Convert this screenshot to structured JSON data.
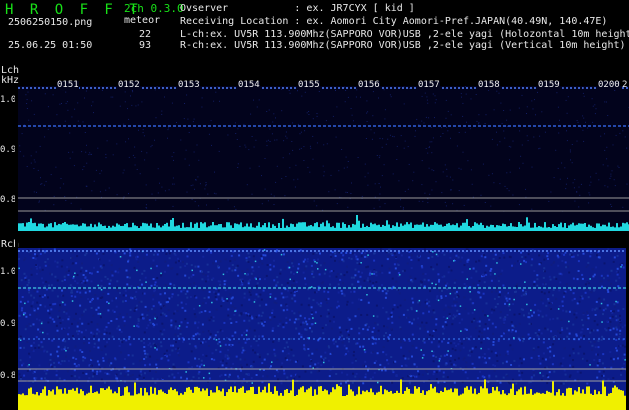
{
  "header": {
    "app_title": "H R O F F T",
    "mode": "2ch 0.3.0",
    "filename": "2506250150.png",
    "datetime": "25.06.25 01:50",
    "meteor_label": "meteor",
    "count_lch": "22",
    "count_rch": "93",
    "observer_line": "Ovserver           : ex. JR7CYX [ kid ]",
    "location_line": "Receiving Location : ex. Aomori City Aomori-Pref.JAPAN(40.49N, 140.47E)",
    "lch_line": "L-ch:ex. UV5R 113.900Mhz(SAPPORO VOR)USB ,2-ele yagi (Holozontal 10m height",
    "rch_line": "R-ch:ex. UV5R 113.900Mhz(SAPPORO VOR)USB ,2-ele yagi (Vertical 10m height)"
  },
  "lch": {
    "label": "Lch",
    "unit": "kHz",
    "y_ticks": [
      "1.0",
      "0.9",
      "0.8"
    ]
  },
  "rch": {
    "label": "Rch",
    "y_ticks": [
      "1.0",
      "0.9",
      "0.8"
    ]
  },
  "time_ticks": [
    "0151",
    "0152",
    "0153",
    "0154",
    "0155",
    "0156",
    "0157",
    "0158",
    "0159",
    "0200"
  ],
  "edge_tick": "2",
  "colors": {
    "title_green": "#18e018",
    "lch_background": "#02031c",
    "rch_background": "#0c1c8a",
    "lch_noise_floor": "#20d8e0",
    "rch_noise_floor": "#f0f000",
    "carrier_line": "#3a70ff"
  }
}
